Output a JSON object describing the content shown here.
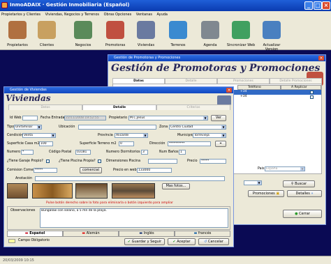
{
  "app": {
    "title": "InmoADAIX · Gestión Inmobiliaria (Español)"
  },
  "menu": [
    "Propietarios y Clientes",
    "Viviendas, Negocios y Terrenos",
    "Obras Opciones",
    "Ventanas",
    "Ayuda"
  ],
  "toolbar": [
    "Propietarios",
    "Clientes",
    "Negocios",
    "Promotoras",
    "Viviendas",
    "Terrenos",
    "Agenda",
    "Sincronizar Web",
    "Actualizar Version"
  ],
  "toolbar_colors": [
    "#b07040",
    "#c8a060",
    "#5a8a5a",
    "#c05040",
    "#6a7aa0",
    "#3a8ad0",
    "#808890",
    "#40a060",
    "#4a80c0"
  ],
  "statusbar": "20/03/2009  10:15",
  "promo": {
    "window_title": "Gestión de Promotoras y Promociones",
    "heading": "Gestión de Promotoras y Promociones",
    "tabs": [
      "Datos",
      "Detalle",
      "Promociones",
      "Detalle Promociones"
    ],
    "grid_headers": [
      "Teléfono",
      "A Replicar"
    ],
    "rows": [
      [
        "+34",
        ""
      ],
      [
        "+34",
        ""
      ]
    ],
    "pais_label": "Pais",
    "pais_value": "España",
    "buscar": "Buscar",
    "promociones_btn": "Promociones",
    "detalles_btn": "Detalles",
    "cerrar_btn": "Cerrar"
  },
  "viv": {
    "window_title": "Gestión de Viviendas",
    "heading": "Viviendas",
    "tabs": [
      "Datos",
      "Detalle",
      "Criterios"
    ],
    "idweb_label": "Id Web",
    "fecha_label": "Fecha Entrada",
    "fecha_value": "22/11/2008 19:52:55",
    "propietario_label": "Propietario",
    "propietario_value": "M.C.Jesus",
    "ver_btn": "Ver",
    "tipo_label": "Tipo",
    "tipo_value": "Unifamiliar",
    "ubicacion_label": "Ubicación",
    "zona_label": "Zona",
    "zona_value": "Centro Ciudad",
    "condicion_label": "Condición",
    "condicion_value": "Venta",
    "provincia_label": "Provincia",
    "provincia_value": "Alicante",
    "municipio_label": "Municipio",
    "municipio_value": "Torrevieja",
    "sup_casa_label": "Superficie Casa m2",
    "sup_casa_value": "100",
    "sup_terreno_label": "Superficie Terreno m2",
    "sup_terreno_value": "0",
    "direccion_label": "Dirección",
    "direccion_value": "**********",
    "numero_label": "Numero",
    "numero_value": "*",
    "cp_label": "Código Postal",
    "cp_value": "03181",
    "dorm_label": "Numero Dormitorios",
    "dorm_value": "3",
    "banos_label": "Num Baños",
    "banos_value": "1",
    "garaje_label": "¿Tiene Garaje Propio?",
    "piscina_label": "¿Tiene Piscina Propia?",
    "dim_label": "Dimensiones Piscina",
    "precio_label": "Precio",
    "precio_value": "*****",
    "comision_label": "Comision Comercial",
    "comision_value": "*****",
    "comercial_btn": "comercial",
    "precio_web_label": "Precio en web",
    "precio_web_value": "133000",
    "anotacion_label": "Anotación",
    "mas_fotos": "Mas fotos...",
    "photo_hint": "Pulse botón derecho sobre la foto para eliminarla o botón izquierdo para ampliar",
    "obs_label": "Observaciones",
    "obs_value": "Bungalow con solano, a 5 mn de la playa.",
    "lang_tabs": [
      "Español",
      "Alemán",
      "Inglés",
      "francés"
    ],
    "campo_label": "Campo Obligatorio",
    "guardar_btn": "Guardar y Seguir",
    "aceptar_btn": "Aceptar",
    "cancelar_btn": "Cancelar"
  }
}
